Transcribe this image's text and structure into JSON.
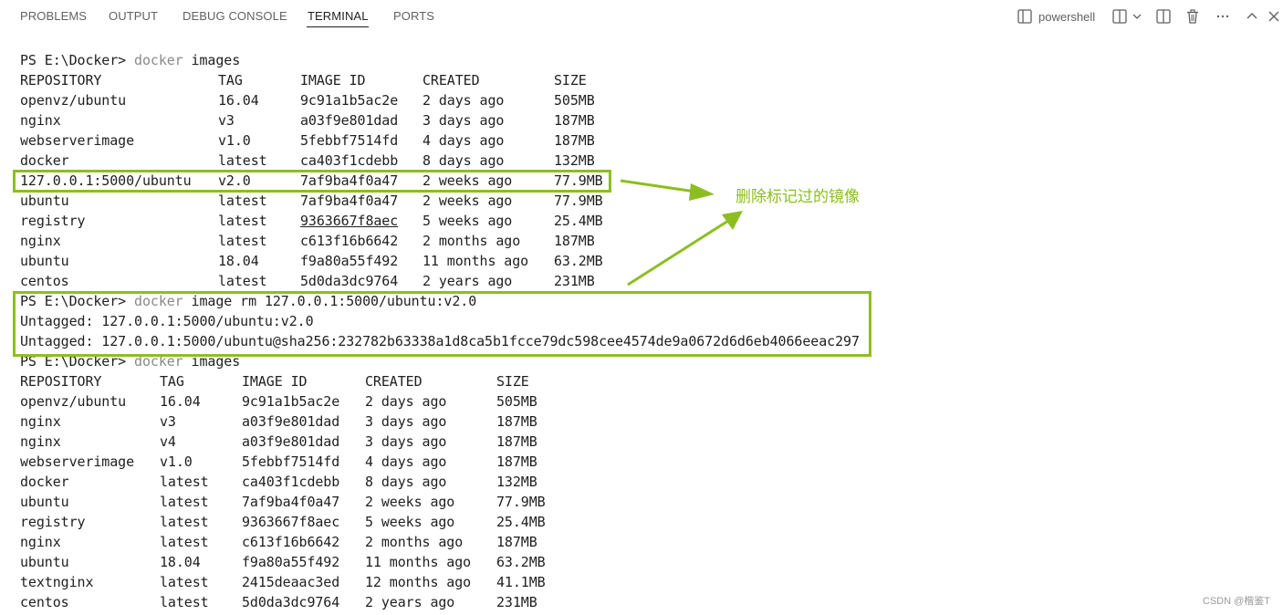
{
  "panel": {
    "tabs": [
      {
        "label": "PROBLEMS"
      },
      {
        "label": "OUTPUT"
      },
      {
        "label": "DEBUG CONSOLE"
      },
      {
        "label": "TERMINAL"
      },
      {
        "label": "PORTS"
      }
    ],
    "active_tab": "TERMINAL",
    "toolbar": {
      "terminal_icon": "terminal-icon",
      "shell_label": "powershell",
      "split_icon": "split-terminal-icon",
      "dropdown_icon": "chevron-down-icon",
      "layout_icon": "panel-layout-icon",
      "trash_icon": "trash-icon",
      "more_icon": "ellipsis-icon",
      "collapse_icon": "chevron-up-icon",
      "close_icon": "close-icon"
    }
  },
  "terminal": {
    "prompt1": "PS E:\\Docker> ",
    "cmd1": "docker",
    "cmd1_args": " images",
    "table1": {
      "headers": [
        "REPOSITORY",
        "TAG",
        "IMAGE ID",
        "CREATED",
        "SIZE"
      ],
      "rows": [
        [
          "openvz/ubuntu",
          "16.04",
          "9c91a1b5ac2e",
          "2 days ago",
          "505MB"
        ],
        [
          "nginx",
          "v3",
          "a03f9e801dad",
          "3 days ago",
          "187MB"
        ],
        [
          "webserverimage",
          "v1.0",
          "5febbf7514fd",
          "4 days ago",
          "187MB"
        ],
        [
          "docker",
          "latest",
          "ca403f1cdebb",
          "8 days ago",
          "132MB"
        ],
        [
          "127.0.0.1:5000/ubuntu",
          "v2.0",
          "7af9ba4f0a47",
          "2 weeks ago",
          "77.9MB"
        ],
        [
          "ubuntu",
          "latest",
          "7af9ba4f0a47",
          "2 weeks ago",
          "77.9MB"
        ],
        [
          "registry",
          "latest",
          "9363667f8aec",
          "5 weeks ago",
          "25.4MB"
        ],
        [
          "nginx",
          "latest",
          "c613f16b6642",
          "2 months ago",
          "187MB"
        ],
        [
          "ubuntu",
          "18.04",
          "f9a80a55f492",
          "11 months ago",
          "63.2MB"
        ],
        [
          "centos",
          "latest",
          "5d0da3dc9764",
          "2 years ago",
          "231MB"
        ]
      ]
    },
    "prompt2": "PS E:\\Docker> ",
    "cmd2": "docker",
    "cmd2_args": " image rm 127.0.0.1:5000/ubuntu:v2.0",
    "out1": "Untagged: 127.0.0.1:5000/ubuntu:v2.0",
    "out2": "Untagged: 127.0.0.1:5000/ubuntu@sha256:232782b63338a1d8ca5b1fcce79dc598cee4574de9a0672d6d6eb4066eeac297",
    "prompt3": "PS E:\\Docker> ",
    "cmd3": "docker",
    "cmd3_args": " images",
    "table2": {
      "headers": [
        "REPOSITORY",
        "TAG",
        "IMAGE ID",
        "CREATED",
        "SIZE"
      ],
      "rows": [
        [
          "openvz/ubuntu",
          "16.04",
          "9c91a1b5ac2e",
          "2 days ago",
          "505MB"
        ],
        [
          "nginx",
          "v3",
          "a03f9e801dad",
          "3 days ago",
          "187MB"
        ],
        [
          "nginx",
          "v4",
          "a03f9e801dad",
          "3 days ago",
          "187MB"
        ],
        [
          "webserverimage",
          "v1.0",
          "5febbf7514fd",
          "4 days ago",
          "187MB"
        ],
        [
          "docker",
          "latest",
          "ca403f1cdebb",
          "8 days ago",
          "132MB"
        ],
        [
          "ubuntu",
          "latest",
          "7af9ba4f0a47",
          "2 weeks ago",
          "77.9MB"
        ],
        [
          "registry",
          "latest",
          "9363667f8aec",
          "5 weeks ago",
          "25.4MB"
        ],
        [
          "nginx",
          "latest",
          "c613f16b6642",
          "2 months ago",
          "187MB"
        ],
        [
          "ubuntu",
          "18.04",
          "f9a80a55f492",
          "11 months ago",
          "63.2MB"
        ],
        [
          "textnginx",
          "latest",
          "2415deaac3ed",
          "12 months ago",
          "41.1MB"
        ],
        [
          "centos",
          "latest",
          "5d0da3dc9764",
          "2 years ago",
          "231MB"
        ]
      ]
    }
  },
  "annotation": {
    "text": "删除标记过的镜像",
    "color": "#8cbe22"
  },
  "watermark": "CSDN @楷鉴T"
}
